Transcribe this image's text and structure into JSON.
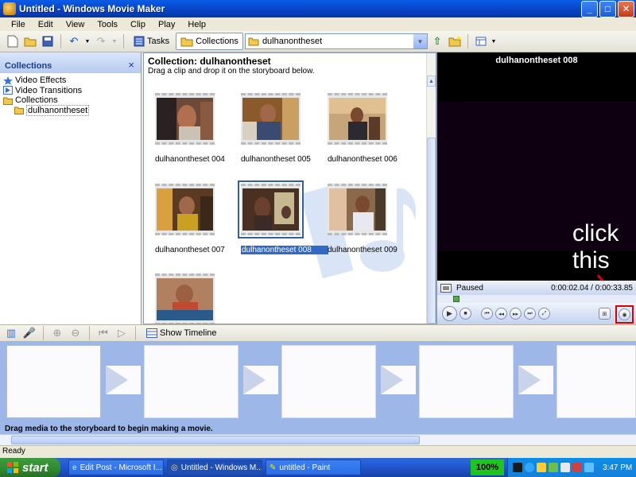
{
  "window": {
    "title": "Untitled - Windows Movie Maker"
  },
  "menu": [
    "File",
    "Edit",
    "View",
    "Tools",
    "Clip",
    "Play",
    "Help"
  ],
  "toolbar": {
    "tasks_label": "Tasks",
    "collections_label": "Collections",
    "collection_value": "dulhanontheset"
  },
  "left_panel": {
    "title": "Collections",
    "close_glyph": "×",
    "items": [
      "Video Effects",
      "Video Transitions",
      "Collections",
      "dulhanontheset"
    ]
  },
  "collection": {
    "title": "Collection: dulhanontheset",
    "subtitle": "Drag a clip and drop it on the storyboard below.",
    "clips": [
      "dulhanontheset 004",
      "dulhanontheset 005",
      "dulhanontheset 006",
      "dulhanontheset 007",
      "dulhanontheset 008",
      "dulhanontheset 009",
      ""
    ],
    "selected_clip": "dulhanontheset 008"
  },
  "monitor": {
    "title": "dulhanontheset 008",
    "status": "Paused",
    "time": "0:00:02.04 / 0:00:33.85",
    "annotation": [
      "click",
      "this"
    ]
  },
  "storyboard": {
    "show_timeline_label": "Show Timeline",
    "hint": "Drag media to the storyboard to begin making a movie."
  },
  "statusbar": {
    "text": "Ready"
  },
  "taskbar": {
    "start_label": "start",
    "tasks": [
      "Edit Post - Microsoft I...",
      "Untitled - Windows M...",
      "untitled - Paint"
    ],
    "battery": "100%",
    "clock": "3:47 PM"
  },
  "colors": {
    "titlebar": "#0842c4",
    "storyboard_bg": "#9db7e8",
    "annotation_box": "#e00000",
    "taskbar": "#245edb"
  }
}
